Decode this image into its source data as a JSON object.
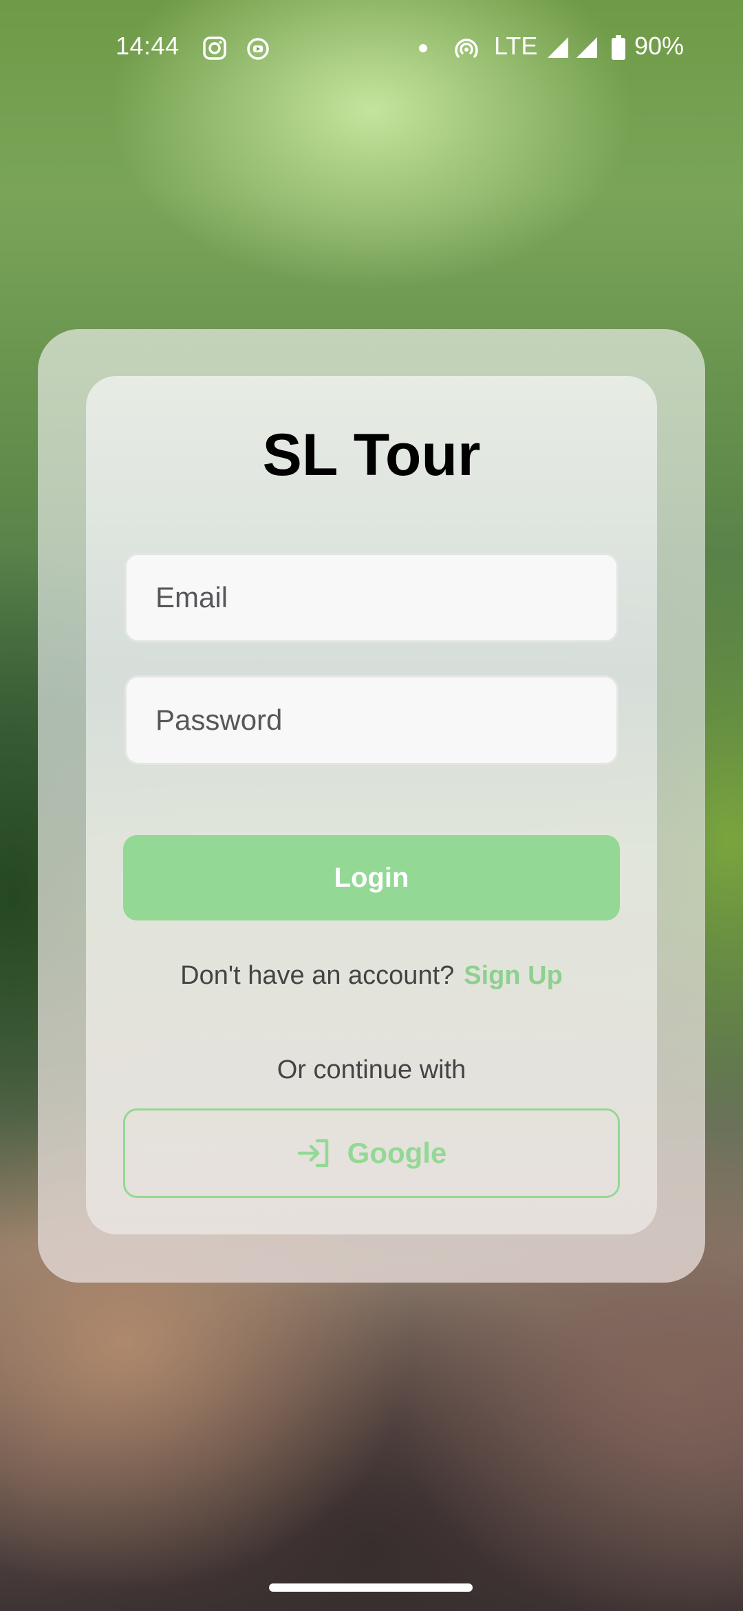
{
  "status_bar": {
    "time": "14:44",
    "network": "LTE",
    "battery": "90%",
    "icons": [
      "instagram-icon",
      "youtube-icon",
      "dot-icon",
      "hotspot-icon",
      "signal-icon",
      "signal-icon",
      "battery-icon"
    ]
  },
  "login": {
    "title": "SL Tour",
    "email_placeholder": "Email",
    "password_placeholder": "Password",
    "login_label": "Login",
    "no_account_text": "Don't have an account?",
    "signup_label": "Sign Up",
    "or_text": "Or continue with",
    "google_label": "Google"
  },
  "colors": {
    "accent": "#93d894",
    "title": "#000000"
  }
}
